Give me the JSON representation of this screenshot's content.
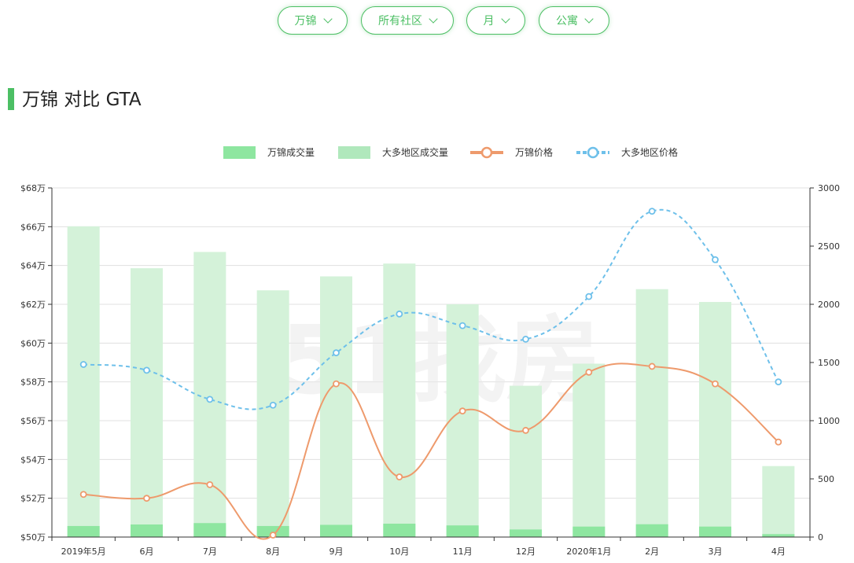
{
  "filters": [
    {
      "label": "万锦"
    },
    {
      "label": "所有社区"
    },
    {
      "label": "月"
    },
    {
      "label": "公寓"
    }
  ],
  "title": "万锦 对比 GTA",
  "watermark": "51找房",
  "colors": {
    "accent": "#4cbf64",
    "bar_local": "#8ee6a0",
    "bar_gta": "#d4f2d9",
    "line_local": "#ee9a6c",
    "line_gta": "#6ec0ea"
  },
  "chart_data": {
    "type": "bar",
    "categories": [
      "2019年5月",
      "6月",
      "7月",
      "8月",
      "9月",
      "10月",
      "11月",
      "12月",
      "2020年1月",
      "2月",
      "3月",
      "4月"
    ],
    "series": [
      {
        "name": "万锦成交量",
        "type": "bar",
        "axis": "right",
        "values": [
          95,
          108,
          120,
          95,
          105,
          115,
          100,
          65,
          90,
          110,
          90,
          25
        ]
      },
      {
        "name": "大多地区成交量",
        "type": "bar",
        "axis": "right",
        "values": [
          2670,
          2310,
          2450,
          2120,
          2240,
          2350,
          2000,
          1300,
          1490,
          2130,
          2020,
          610
        ]
      },
      {
        "name": "万锦价格",
        "type": "line",
        "axis": "left",
        "values": [
          52.2,
          52.0,
          52.7,
          50.1,
          57.9,
          53.1,
          56.5,
          55.5,
          58.5,
          58.8,
          57.9,
          54.9
        ]
      },
      {
        "name": "大多地区价格",
        "type": "line",
        "axis": "left",
        "dashed": true,
        "values": [
          58.9,
          58.6,
          57.1,
          56.8,
          59.5,
          61.5,
          60.9,
          60.2,
          62.4,
          66.8,
          64.3,
          58.0
        ]
      }
    ],
    "y_left": {
      "min": 50,
      "max": 68,
      "step": 2,
      "ticks": [
        "$50万",
        "$52万",
        "$54万",
        "$56万",
        "$58万",
        "$60万",
        "$62万",
        "$64万",
        "$66万",
        "$68万"
      ]
    },
    "y_right": {
      "min": 0,
      "max": 3000,
      "step": 500,
      "ticks": [
        "0",
        "500",
        "1000",
        "1500",
        "2000",
        "2500",
        "3000"
      ]
    },
    "legend_position": "top-center",
    "grid": true
  }
}
